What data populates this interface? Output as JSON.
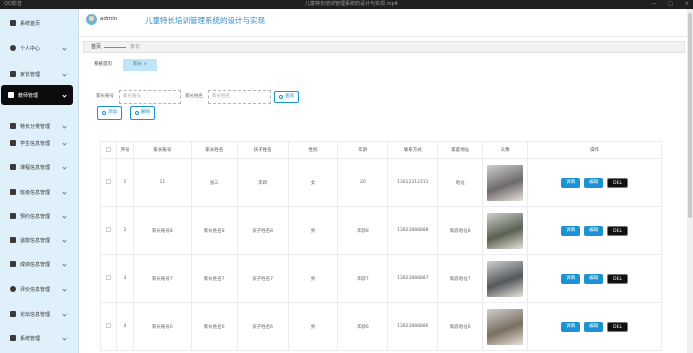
{
  "window": {
    "app_name": "QQ影音",
    "title": "儿童特长培训管理系统的设计与实现.mp4",
    "controls": [
      "—",
      "□",
      "×"
    ]
  },
  "header": {
    "user": "admin",
    "system_title": "儿童特长培训管理系统的设计与实现"
  },
  "sidebar": {
    "items": [
      {
        "label": "系统首页",
        "icon": "home-icon",
        "active": false,
        "has_chevron": false
      },
      {
        "label": "个人中心",
        "icon": "user-icon",
        "active": false,
        "has_chevron": true
      },
      {
        "label": "家长管理",
        "icon": "grid-icon",
        "active": false,
        "has_chevron": true
      },
      {
        "label": "教师管理",
        "icon": "teacher-icon",
        "active": true,
        "has_chevron": true
      },
      {
        "label": "特长分类管理",
        "icon": "grid-icon",
        "active": false,
        "has_chevron": true
      },
      {
        "label": "学生信息管理",
        "icon": "grid-icon",
        "active": false,
        "has_chevron": true
      },
      {
        "label": "课程信息管理",
        "icon": "grid-icon",
        "active": false,
        "has_chevron": true
      },
      {
        "label": "班级信息管理",
        "icon": "grid-icon",
        "active": false,
        "has_chevron": true
      },
      {
        "label": "预约信息管理",
        "icon": "grid-icon",
        "active": false,
        "has_chevron": true
      },
      {
        "label": "退款信息管理",
        "icon": "grid-icon",
        "active": false,
        "has_chevron": true
      },
      {
        "label": "成绩信息管理",
        "icon": "grid-icon",
        "active": false,
        "has_chevron": true
      },
      {
        "label": "评价信息管理",
        "icon": "person-icon",
        "active": false,
        "has_chevron": true
      },
      {
        "label": "论坛信息管理",
        "icon": "grid-icon",
        "active": false,
        "has_chevron": true
      },
      {
        "label": "系统管理",
        "icon": "grid-icon",
        "active": false,
        "has_chevron": true
      }
    ]
  },
  "breadcrumb": {
    "home": "首页",
    "current": "家长"
  },
  "tabs": [
    {
      "label": "系统首页",
      "active": false
    },
    {
      "label": "家长 ×",
      "active": true
    }
  ],
  "search": {
    "field1_label": "家长账号",
    "field1_placeholder": "家长账号",
    "field2_label": "家长姓名",
    "field2_placeholder": "家长姓名",
    "search_button": "查询"
  },
  "actions": {
    "add": "添加",
    "delete": "删除"
  },
  "table": {
    "columns": [
      "",
      "序号",
      "家长账号",
      "家长姓名",
      "孩子姓名",
      "性别",
      "年龄",
      "联系方式",
      "家庭地址",
      "头像",
      "操作"
    ],
    "rows": [
      {
        "index": "1",
        "account": "11",
        "name": "张三",
        "child": "李四",
        "gender": "女",
        "age": "20",
        "phone": "13012312311",
        "address": "地址",
        "photo_color": "#6e6a6a"
      },
      {
        "index": "2",
        "account": "家长账号8",
        "name": "家长姓名8",
        "child": "孩子姓名8",
        "gender": "男",
        "age": "年龄8",
        "phone": "13823888888",
        "address": "家庭地址8",
        "photo_color": "#596150"
      },
      {
        "index": "3",
        "account": "家长账号7",
        "name": "家长姓名7",
        "child": "孩子姓名7",
        "gender": "男",
        "age": "年龄7",
        "phone": "13823888887",
        "address": "家庭地址7",
        "photo_color": "#54585b"
      },
      {
        "index": "4",
        "account": "家长账号6",
        "name": "家长姓名6",
        "child": "孩子姓名6",
        "gender": "男",
        "age": "年龄6",
        "phone": "13823888886",
        "address": "家庭地址6",
        "photo_color": "#7a6f60"
      }
    ],
    "op_labels": {
      "detail": "详情",
      "edit": "编辑",
      "del": "DEL"
    }
  }
}
